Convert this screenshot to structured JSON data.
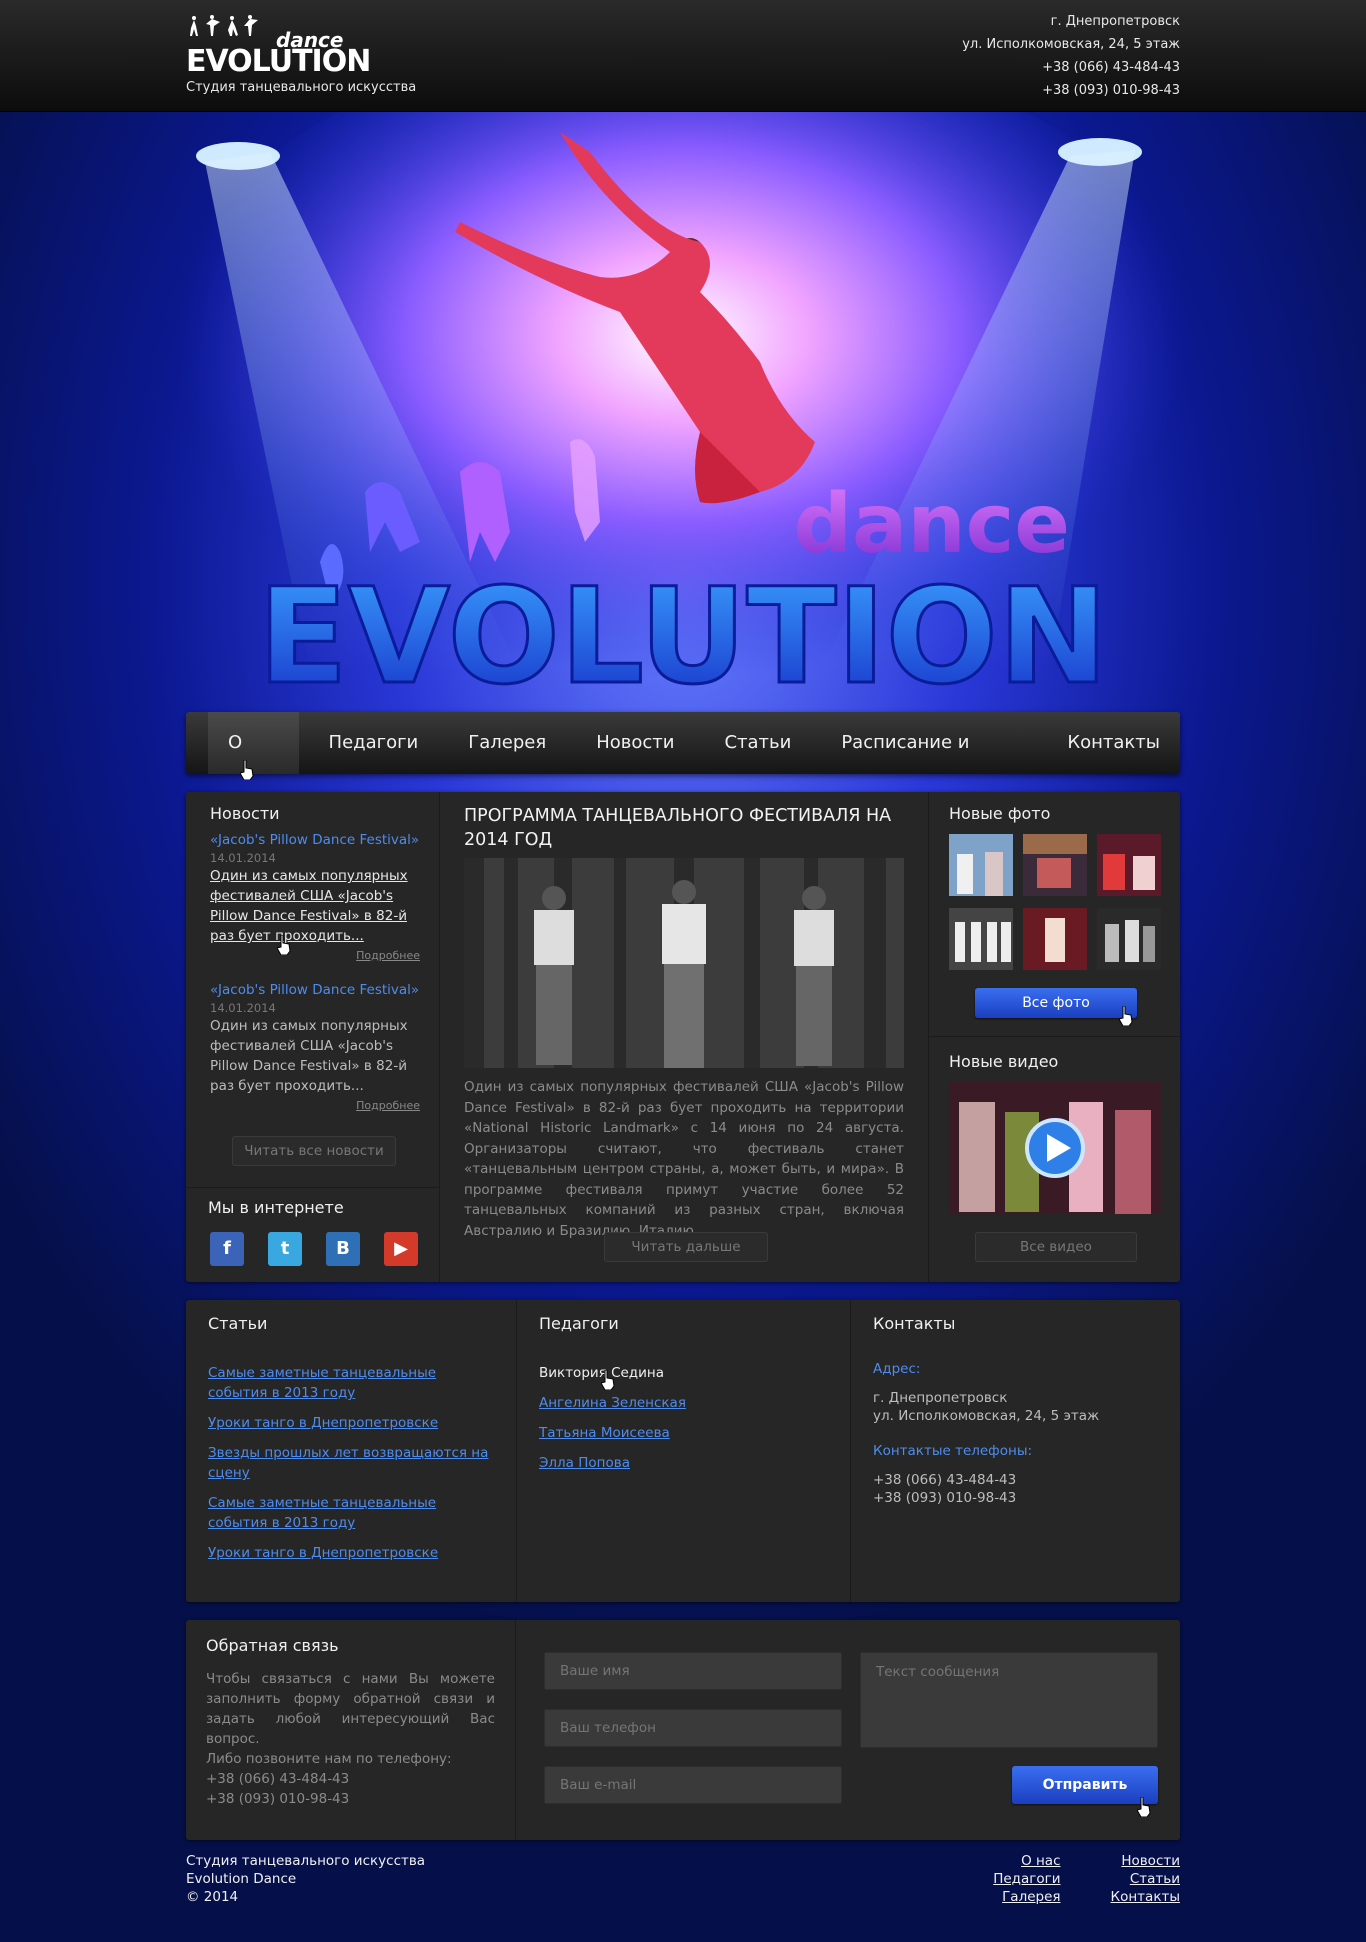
{
  "header": {
    "logo_small": "dance",
    "logo_big": "EVOLUTION",
    "tagline": "Студия танцевального искусства",
    "city": "г. Днепропетровск",
    "address": "ул. Исполкомовская, 24, 5 этаж",
    "phone1": "+38 (066) 43-484-43",
    "phone2": "+38 (093) 010-98-43"
  },
  "hero": {
    "word_small": "dance",
    "word_big": "EVOLUTION"
  },
  "nav": {
    "items": [
      "О нас",
      "Педагоги",
      "Галерея",
      "Новости",
      "Статьи",
      "Расписание и цены",
      "Контакты"
    ],
    "active": "О нас"
  },
  "news": {
    "title": "Новости",
    "items": [
      {
        "link": "«Jacob's Pillow Dance Festival»",
        "date": "14.01.2014",
        "text": "Один из самых популярных фестивалей США «Jacob's Pillow Dance Festival» в 82-й раз бует проходить...",
        "more": "Подробнее"
      },
      {
        "link": "«Jacob's Pillow Dance Festival»",
        "date": "14.01.2014",
        "text": "Один из самых популярных фестивалей США «Jacob's Pillow Dance Festival» в 82-й раз бует проходить...",
        "more": "Подробнее"
      }
    ],
    "all_button": "Читать все новости"
  },
  "social": {
    "title": "Мы в интернете",
    "icons": [
      "facebook-icon",
      "twitter-icon",
      "vk-icon",
      "youtube-icon"
    ]
  },
  "article": {
    "title": "ПРОГРАММА ТАНЦЕВАЛЬНОГО ФЕСТИВАЛЯ НА 2014 ГОД",
    "text": "Один из самых популярных фестивалей США «Jacob's Pillow Dance Festival» в 82-й раз бует проходить на территории «National Historic Landmark» с 14 июня по 24 августа. Организаторы считают, что фестиваль станет «танцевальным центром страны, а, может быть, и мира». В программе фестиваля примут участие более 52 танцевальных компаний из разных стран, включая Австралию и Бразилию, Италию...",
    "button": "Читать дальше"
  },
  "photos": {
    "title": "Новые фото",
    "button": "Все фото"
  },
  "videos": {
    "title": "Новые видео",
    "button": "Все видео"
  },
  "articles": {
    "title": "Статьи",
    "items": [
      "Самые заметные танцевальные события в 2013 году",
      "Уроки танго в Днепропетровске",
      "Звезды прошлых лет возвращаются на сцену",
      "Самые заметные танцевальные события в 2013 году",
      "Уроки танго в Днепропетровске"
    ]
  },
  "teachers": {
    "title": "Педагоги",
    "items": [
      "Виктория Седина",
      "Ангелина Зеленская",
      "Татьяна Моисеева",
      " Элла Попова"
    ]
  },
  "contacts": {
    "title": "Контакты",
    "address_label": "Адрес:",
    "city": "г. Днепропетровск",
    "street": "ул. Исполкомовская, 24, 5 этаж",
    "phones_label": "Контактые телефоны:",
    "phone1": "+38 (066) 43-484-43",
    "phone2": "+38 (093) 010-98-43"
  },
  "feedback": {
    "title": "Обратная связь",
    "text": "Чтобы связаться с нами Вы можете заполнить форму обратной связи и задать любой интересующий Вас вопрос.",
    "text2": "Либо позвоните нам по телефону:",
    "phone1": "+38 (066) 43-484-43",
    "phone2": "+38 (093) 010-98-43",
    "name_placeholder": "Ваше имя",
    "phone_placeholder": "Ваш телефон",
    "email_placeholder": "Ваш e-mail",
    "message_placeholder": "Текст сообщения",
    "submit": "Отправить"
  },
  "footer": {
    "line1": "Студия танцевального искусства",
    "line2": "Evolution Dance",
    "line3": "© 2014",
    "links": [
      "О нас",
      "Новости",
      "Педагоги",
      "Статьи",
      "Галерея",
      "Контакты"
    ]
  },
  "colors": {
    "accent": "#4d8cf0",
    "panel": "#262626",
    "button_blue": "#2a55d8"
  }
}
